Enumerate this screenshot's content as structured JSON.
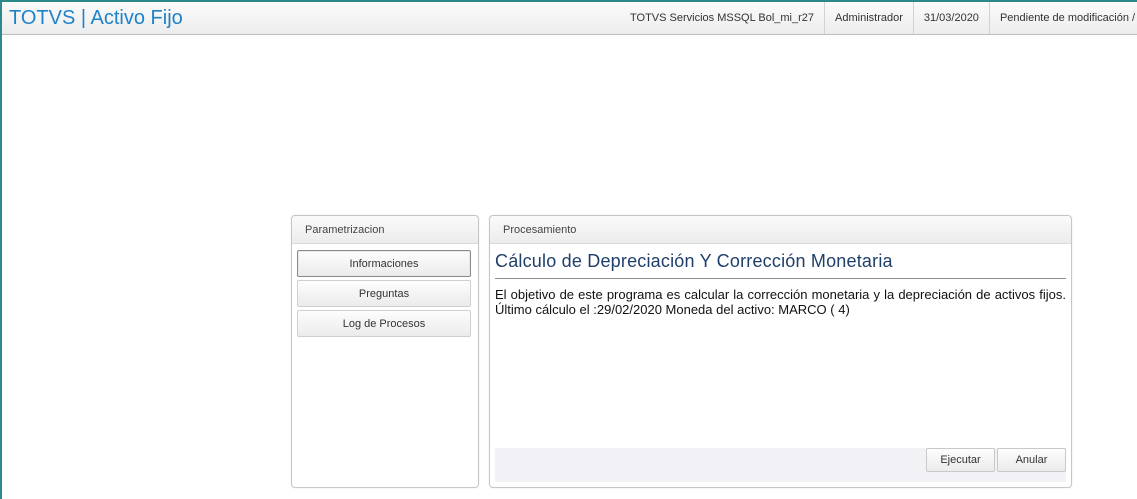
{
  "header": {
    "app_title": "TOTVS | Activo Fijo",
    "environment": "TOTVS Servicios MSSQL Bol_mi_r27",
    "user": "Administrador",
    "date": "31/03/2020",
    "status": "Pendiente de modificación / Per"
  },
  "sidebar": {
    "title": "Parametrizacion",
    "items": [
      {
        "label": "Informaciones",
        "active": true
      },
      {
        "label": "Preguntas",
        "active": false
      },
      {
        "label": "Log de Procesos",
        "active": false
      }
    ]
  },
  "process": {
    "panel_title": "Procesamiento",
    "heading": "Cálculo de Depreciación Y Corrección Monetaria",
    "description": "El objetivo de este programa es calcular la corrección monetaria y la depreciación de activos fijos. Último cálculo el :29/02/2020 Moneda del activo: MARCO ( 4)",
    "execute_label": "Ejecutar",
    "cancel_label": "Anular"
  },
  "colors": {
    "accent": "#1e82c8",
    "heading": "#1f3f6a",
    "frame": "#2d8a8a"
  }
}
